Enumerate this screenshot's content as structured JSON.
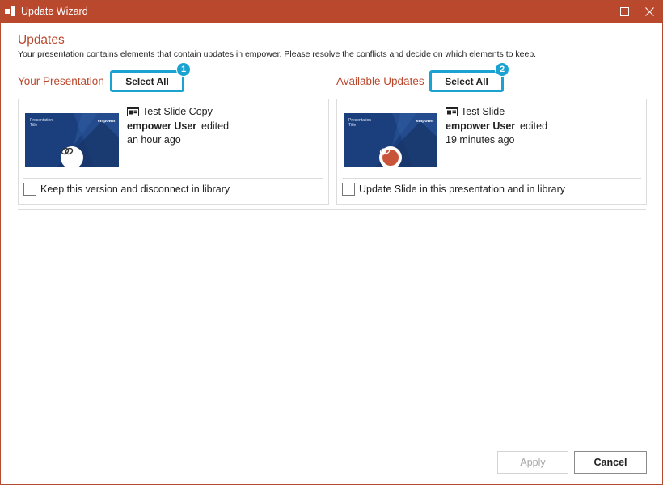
{
  "window": {
    "title": "Update Wizard",
    "accent_color": "#b9482d",
    "highlight_color": "#1aa3d1"
  },
  "header": {
    "heading": "Updates",
    "description": "Your presentation contains elements that contain updates in empower. Please resolve the conflicts and decide on which elements to keep."
  },
  "columns": [
    {
      "label": "Your Presentation",
      "select_all_label": "Select All",
      "badge": "1",
      "card": {
        "thumbnail_title": "Presentation\nTitle",
        "thumbnail_brand": "empower",
        "slide_name": "Test Slide Copy",
        "user": "empower User",
        "action": "edited",
        "time": "an hour ago",
        "status_icon": "link-icon",
        "checkbox_label": "Keep this version and disconnect in library",
        "checked": false
      }
    },
    {
      "label": "Available Updates",
      "select_all_label": "Select All",
      "badge": "2",
      "card": {
        "thumbnail_title": "Presentation\nTitle",
        "thumbnail_brand": "empower",
        "slide_name": "Test Slide",
        "user": "empower User",
        "action": "edited",
        "time": "19 minutes ago",
        "status_icon": "broken-link-icon",
        "checkbox_label": "Update Slide in this presentation and in library",
        "checked": false
      }
    }
  ],
  "footer": {
    "apply_label": "Apply",
    "apply_enabled": false,
    "cancel_label": "Cancel"
  }
}
